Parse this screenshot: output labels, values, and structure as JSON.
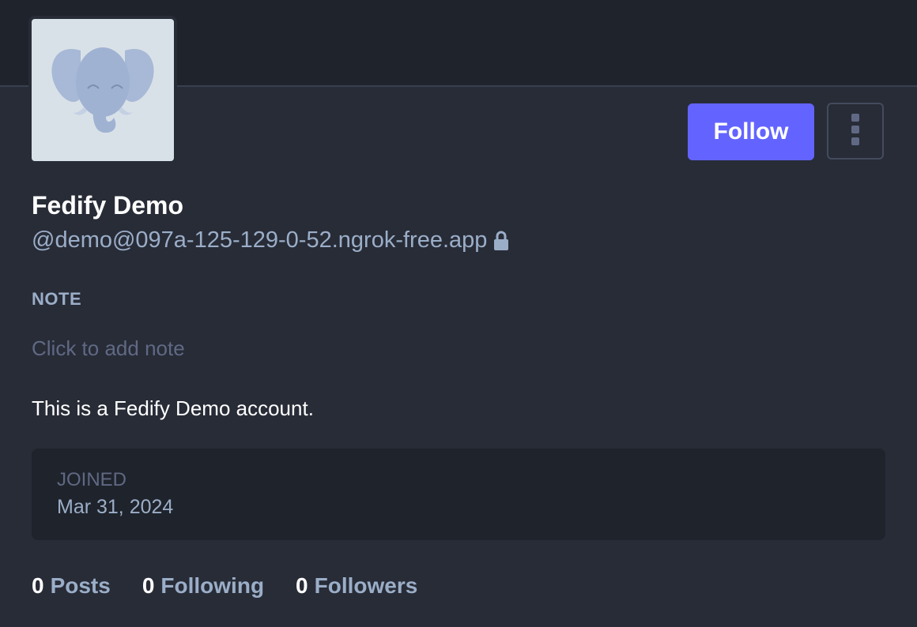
{
  "profile": {
    "display_name": "Fedify Demo",
    "handle": "@demo@097a-125-129-0-52.ngrok-free.app",
    "note_label": "NOTE",
    "note_placeholder": "Click to add note",
    "bio": "This is a Fedify Demo account.",
    "joined_label": "JOINED",
    "joined_date": "Mar 31, 2024",
    "avatar_icon": "elephant-avatar-icon",
    "locked": true
  },
  "actions": {
    "follow_label": "Follow",
    "menu_icon": "vertical-ellipsis-icon"
  },
  "stats": [
    {
      "count": "0",
      "label": "Posts"
    },
    {
      "count": "0",
      "label": "Following"
    },
    {
      "count": "0",
      "label": "Followers"
    }
  ],
  "colors": {
    "accent": "#6364ff",
    "background": "#282c37",
    "banner": "#1f232b",
    "secondary_text": "#9baec8"
  }
}
